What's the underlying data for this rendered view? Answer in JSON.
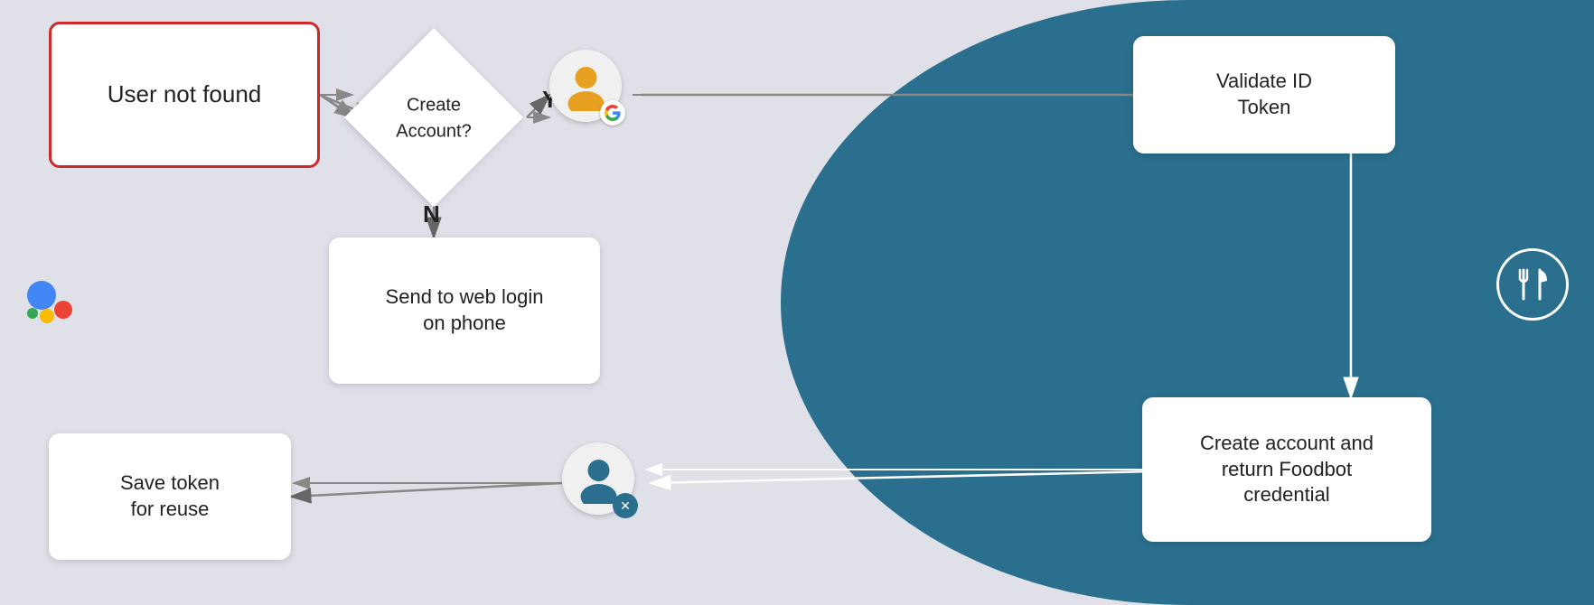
{
  "nodes": {
    "user_not_found": "User not found",
    "create_account_q": "Create\nAccount?",
    "send_web_login": "Send to web login\non phone",
    "save_token": "Save token\nfor reuse",
    "validate_id": "Validate ID\nToken",
    "create_account_return": "Create account and\nreturn Foodbot\ncredential"
  },
  "labels": {
    "yes": "Y",
    "no": "N"
  },
  "colors": {
    "bg_left": "#dfe0e8",
    "bg_right": "#2a6f8e",
    "red_border": "#cc2a2a",
    "white": "#ffffff",
    "text_dark": "#222222",
    "google_orange": "#e8a020",
    "google_blue": "#4285f4",
    "google_red": "#ea4335",
    "google_yellow": "#fbbc04",
    "google_green": "#34a853"
  }
}
